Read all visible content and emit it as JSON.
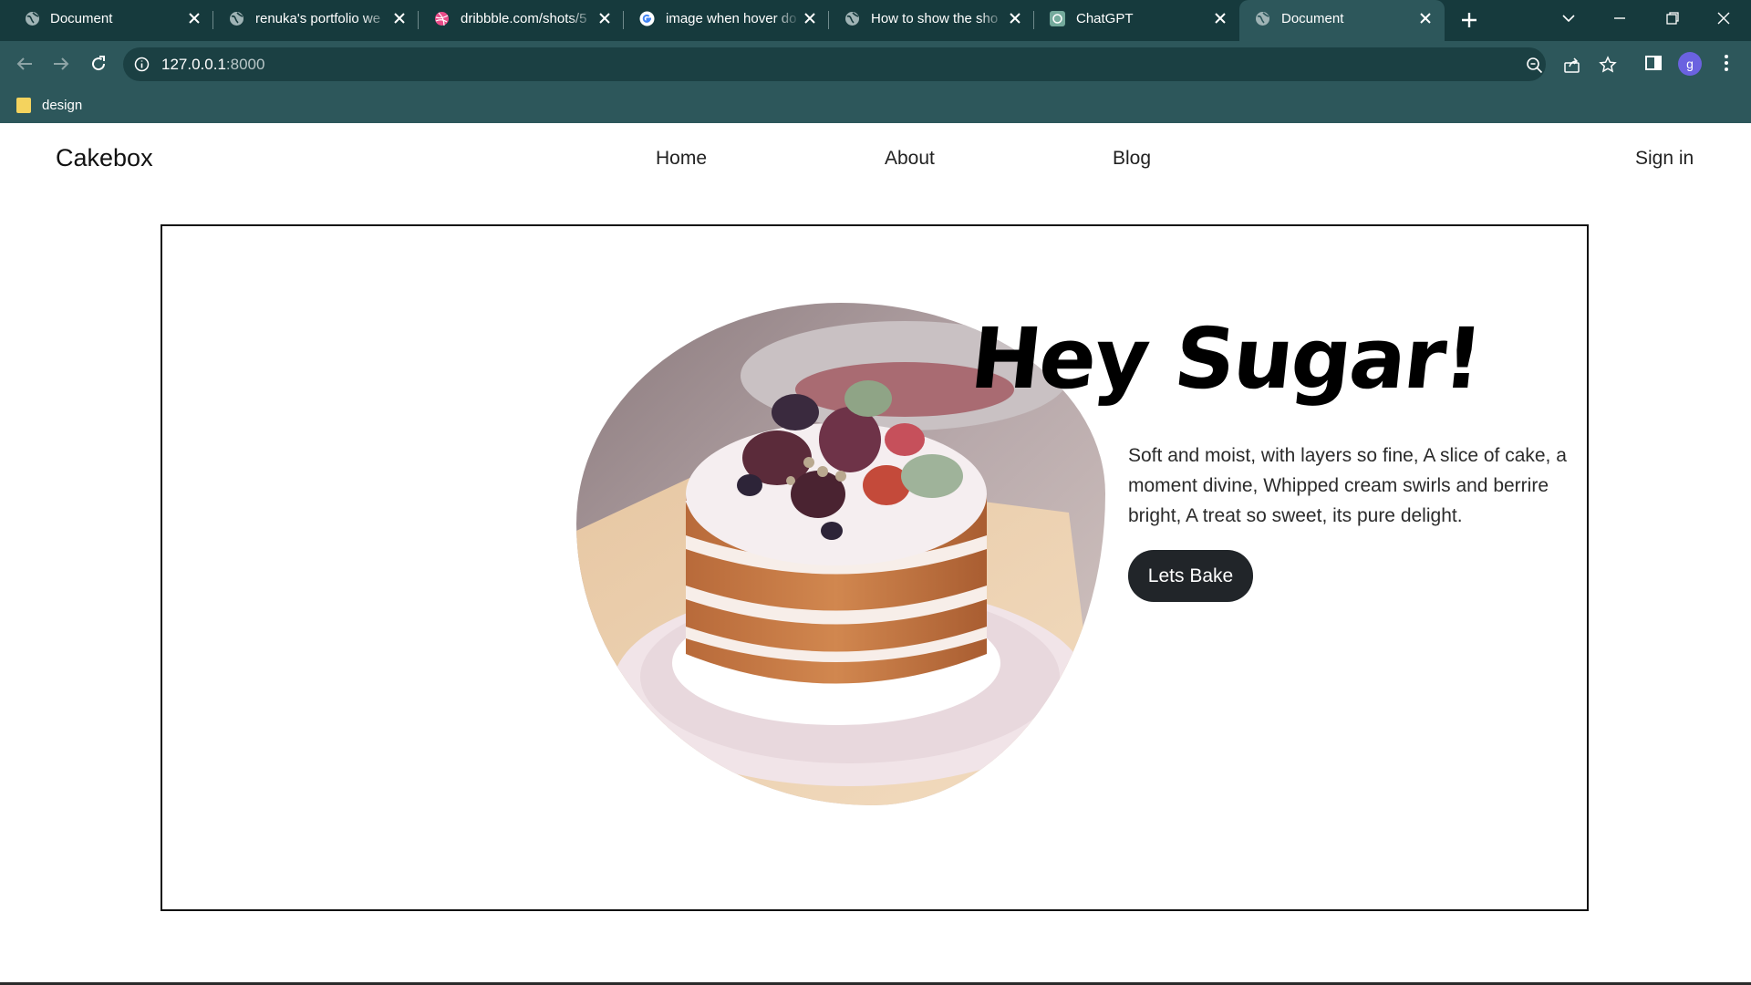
{
  "browser": {
    "tabs": [
      {
        "title": "Document",
        "icon": "globe-icon",
        "active": false
      },
      {
        "title": "renuka's portfolio we",
        "icon": "globe-icon",
        "active": false
      },
      {
        "title": "dribbble.com/shots/5",
        "icon": "dribbble-icon",
        "active": false
      },
      {
        "title": "image when hover do",
        "icon": "google-icon",
        "active": false
      },
      {
        "title": "How to show the sho",
        "icon": "globe-icon",
        "active": false
      },
      {
        "title": "ChatGPT",
        "icon": "chatgpt-icon",
        "active": false
      },
      {
        "title": "Document",
        "icon": "globe-icon",
        "active": true
      }
    ],
    "address": {
      "host": "127.0.0.1",
      "port": ":8000"
    },
    "profile_initial": "g",
    "bookmarks": [
      {
        "label": "design",
        "icon": "folder-icon"
      }
    ],
    "colors": {
      "tabstrip": "#163a3d",
      "toolbar": "#2d575b",
      "omnibox": "#1b4043"
    }
  },
  "site": {
    "logo": "Cakebox",
    "nav": [
      "Home",
      "About",
      "Blog"
    ],
    "sign_in": "Sign in"
  },
  "hero": {
    "title": "Hey Sugar!",
    "text": "Soft and moist, with layers so fine, A slice of cake, a moment divine, Whipped cream swirls and berrire bright, A treat so sweet, its pure delight.",
    "button": "Lets Bake",
    "image": "naked-layer-cake-with-figs-and-berries"
  }
}
